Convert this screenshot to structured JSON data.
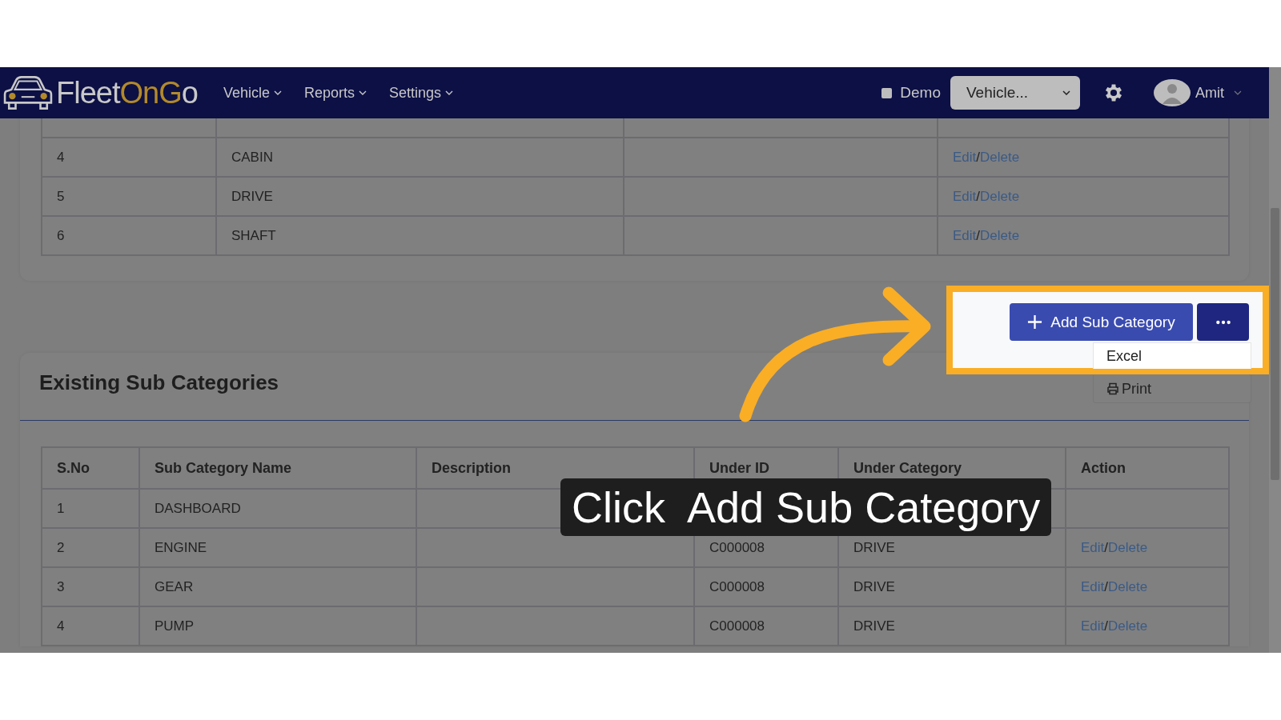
{
  "navbar": {
    "logo_parts": [
      {
        "text": "Fleet",
        "accent": false
      },
      {
        "text": "On",
        "accent": true
      },
      {
        "text": "G",
        "accent": true
      },
      {
        "text": "o",
        "accent": false
      }
    ],
    "menus": [
      "Vehicle",
      "Reports",
      "Settings"
    ],
    "demo": {
      "label": "Demo",
      "checked": false
    },
    "vehicle_select": {
      "value": "Vehicle..."
    },
    "user": {
      "name": "Amit"
    }
  },
  "categories_table": {
    "rows": [
      {
        "sno": "4",
        "name": "CABIN",
        "action": {
          "edit": "Edit",
          "separator": "/",
          "delete": "Delete"
        }
      },
      {
        "sno": "5",
        "name": "DRIVE",
        "action": {
          "edit": "Edit",
          "separator": "/",
          "delete": "Delete"
        }
      },
      {
        "sno": "6",
        "name": "SHAFT",
        "action": {
          "edit": "Edit",
          "separator": "/",
          "delete": "Delete"
        }
      }
    ]
  },
  "toolbar": {
    "add_button": "Add Sub Category",
    "menu": [
      {
        "kind": "excel",
        "label": "Excel"
      },
      {
        "kind": "print",
        "label": "Print"
      }
    ]
  },
  "sub_categories": {
    "title": "Existing Sub Categories",
    "columns": [
      "S.No",
      "Sub Category Name",
      "Description",
      "Under ID",
      "Under Category",
      "Action"
    ],
    "rows": [
      {
        "sno": "1",
        "name": "DASHBOARD"
      },
      {
        "sno": "2",
        "name": "ENGINE",
        "under_id": "C000008",
        "under_category": "DRIVE",
        "action": {
          "edit": "Edit",
          "separator": "/",
          "delete": "Delete"
        }
      },
      {
        "sno": "3",
        "name": "GEAR",
        "under_id": "C000008",
        "under_category": "DRIVE",
        "action": {
          "edit": "Edit",
          "separator": "/",
          "delete": "Delete"
        }
      },
      {
        "sno": "4",
        "name": "PUMP",
        "under_id": "C000008",
        "under_category": "DRIVE",
        "action": {
          "edit": "Edit",
          "separator": "/",
          "delete": "Delete"
        }
      }
    ]
  },
  "caption": "Click  Add Sub Category"
}
